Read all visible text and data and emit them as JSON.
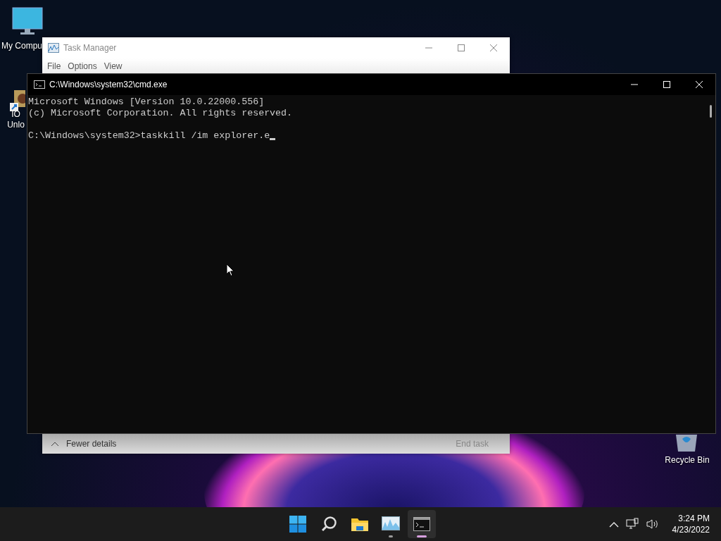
{
  "desktop_icons": [
    {
      "kind": "monitor",
      "lines": [
        "My Compu"
      ]
    },
    {
      "kind": "app",
      "lines": [
        "IO",
        "Unlo"
      ]
    },
    {
      "kind": "recycle-bin",
      "lines": [
        "Recycle Bin"
      ]
    }
  ],
  "task_manager": {
    "title": "Task Manager",
    "menu": [
      "File",
      "Options",
      "View"
    ],
    "details_toggle": "Fewer details",
    "end_task": {
      "label": "End task",
      "disabled": true
    }
  },
  "cmd": {
    "title": "C:\\Windows\\system32\\cmd.exe",
    "output": [
      "Microsoft Windows [Version 10.0.22000.556]",
      "(c) Microsoft Corporation. All rights reserved."
    ],
    "prompt": "C:\\Windows\\system32>taskkill /im explorer.e"
  },
  "taskbar": {
    "apps": [
      {
        "kind": "start",
        "running": false,
        "active": false
      },
      {
        "kind": "search",
        "running": false,
        "active": false
      },
      {
        "kind": "folder",
        "running": false,
        "active": false
      },
      {
        "kind": "monitor-chart",
        "running": true,
        "active": false
      },
      {
        "kind": "terminal",
        "running": true,
        "active": true
      }
    ],
    "time": "3:24 PM",
    "date": "4/23/2022"
  }
}
